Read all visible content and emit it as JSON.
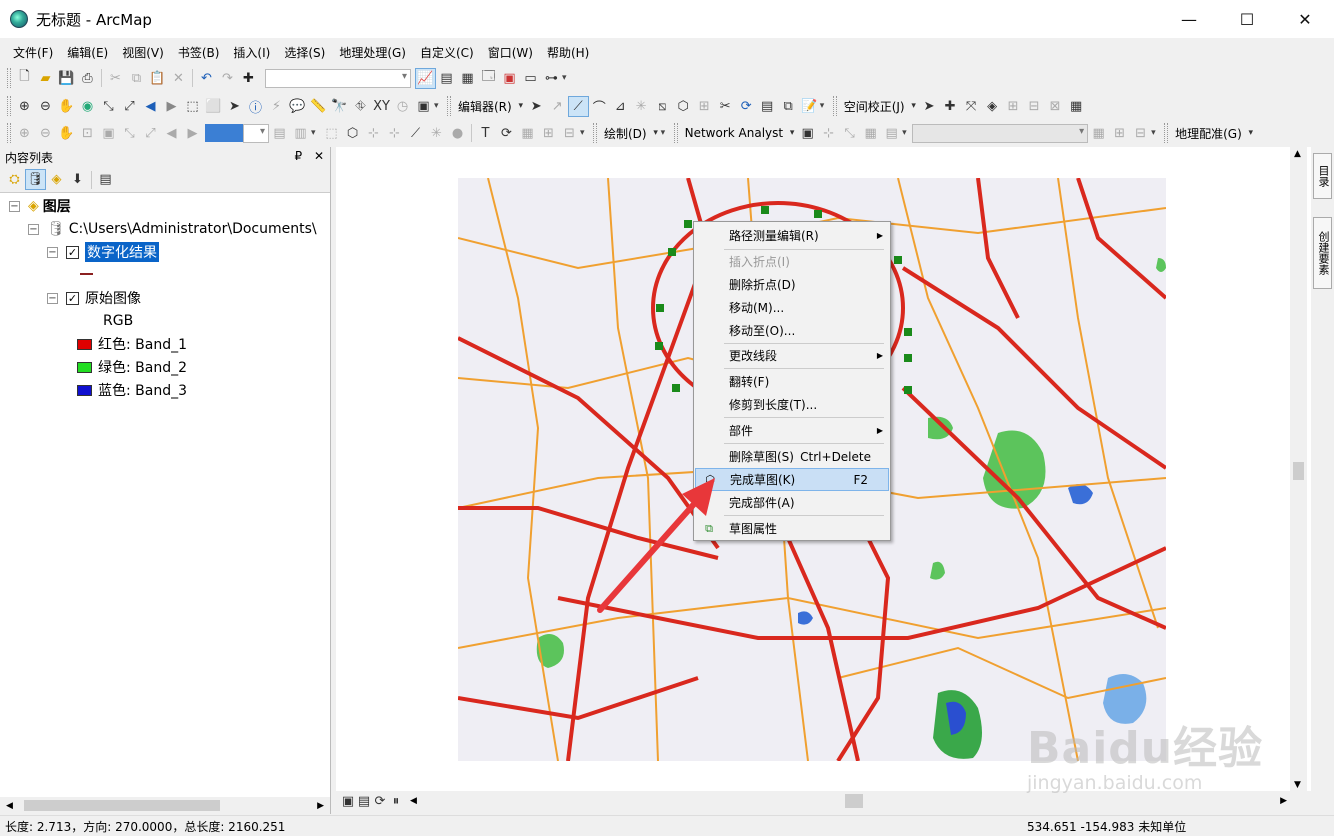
{
  "window": {
    "title": "无标题 - ArcMap",
    "minimize": "—",
    "maximize": "☐",
    "close": "✕"
  },
  "menus": [
    "文件(F)",
    "编辑(E)",
    "视图(V)",
    "书签(B)",
    "插入(I)",
    "选择(S)",
    "地理处理(G)",
    "自定义(C)",
    "窗口(W)",
    "帮助(H)"
  ],
  "toolbars": {
    "editor_label": "编辑器(R)",
    "spatial_adjust_label": "空间校正(J)",
    "draw_label": "绘制(D)",
    "network_analyst_label": "Network Analyst",
    "georef_label": "地理配准(G)"
  },
  "toc": {
    "header": "内容列表",
    "pin": "₽",
    "close": "✕",
    "root_label": "图层",
    "workspace_path": "C:\\Users\\Administrator\\Documents\\",
    "layers": [
      {
        "name": "数字化结果",
        "checked": "✓",
        "selected": true
      },
      {
        "name": "原始图像",
        "checked": "✓",
        "selected": false
      }
    ],
    "raster_type": "RGB",
    "bands": [
      {
        "label": "红色:   Band_1",
        "color": "#e00000"
      },
      {
        "label": "绿色: Band_2",
        "color": "#22dd22"
      },
      {
        "label": "蓝色:   Band_3",
        "color": "#1010d0"
      }
    ]
  },
  "context_menu": {
    "items": [
      {
        "label": "路径测量编辑(R)",
        "submenu": true
      },
      {
        "label": "插入折点(I)",
        "disabled": true
      },
      {
        "label": "删除折点(D)"
      },
      {
        "label": "移动(M)..."
      },
      {
        "label": "移动至(O)..."
      },
      {
        "label": "更改线段",
        "submenu": true
      },
      {
        "label": "翻转(F)"
      },
      {
        "label": "修剪到长度(T)..."
      },
      {
        "label": "部件",
        "submenu": true
      },
      {
        "label": "删除草图(S)",
        "shortcut": "Ctrl+Delete"
      },
      {
        "label": "完成草图(K)",
        "shortcut": "F2",
        "highlight": true
      },
      {
        "label": "完成部件(A)"
      },
      {
        "label": "草图属性"
      }
    ]
  },
  "right_dock": {
    "catalog_tab": "目录",
    "create_features_tab": "创建要素"
  },
  "watermark": {
    "brand": "Baidu经验",
    "url": "jingyan.baidu.com"
  },
  "status": {
    "left": "长度: 2.713，方向: 270.0000，总长度: 2160.251",
    "coords": "534.651   -154.983 未知单位"
  },
  "colors": {
    "selection": "#0a64c8",
    "highlight": "#c9dff5",
    "arrow": "#e8373a",
    "road": "#d9281e",
    "road_minor": "#f0a030",
    "park": "#5cc45c"
  }
}
